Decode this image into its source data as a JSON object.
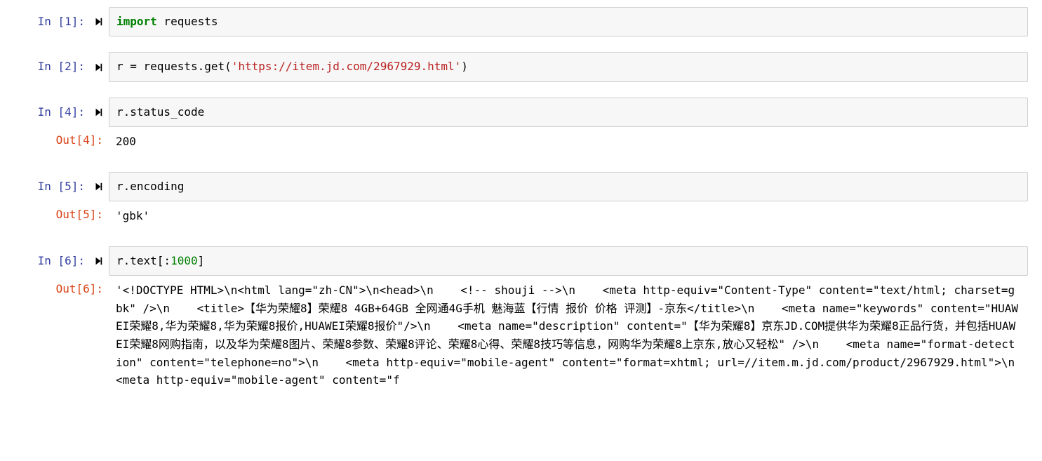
{
  "cells": [
    {
      "n": 1,
      "in_prompt": "In [1]:",
      "code": [
        {
          "t": "import",
          "c": "tok-keyword"
        },
        {
          "t": " requests",
          "c": ""
        }
      ]
    },
    {
      "n": 2,
      "in_prompt": "In [2]:",
      "code": [
        {
          "t": "r ",
          "c": ""
        },
        {
          "t": "=",
          "c": ""
        },
        {
          "t": " requests.get(",
          "c": ""
        },
        {
          "t": "'https://item.jd.com/2967929.html'",
          "c": "tok-string"
        },
        {
          "t": ")",
          "c": ""
        }
      ]
    },
    {
      "n": 4,
      "in_prompt": "In [4]:",
      "code": [
        {
          "t": "r.status_code",
          "c": ""
        }
      ],
      "out_prompt": "Out[4]:",
      "output": "200"
    },
    {
      "n": 5,
      "in_prompt": "In [5]:",
      "code": [
        {
          "t": "r.encoding",
          "c": ""
        }
      ],
      "out_prompt": "Out[5]:",
      "output": "'gbk'"
    },
    {
      "n": 6,
      "in_prompt": "In [6]:",
      "code": [
        {
          "t": "r.text[:",
          "c": ""
        },
        {
          "t": "1000",
          "c": "tok-number"
        },
        {
          "t": "]",
          "c": ""
        }
      ],
      "out_prompt": "Out[6]:",
      "output": "'<!DOCTYPE HTML>\\n<html lang=\"zh-CN\">\\n<head>\\n    <!-- shouji -->\\n    <meta http-equiv=\"Content-Type\" content=\"text/html; charset=gbk\" />\\n    <title>【华为荣耀8】荣耀8 4GB+64GB 全网通4G手机 魅海蓝【行情 报价 价格 评测】-京东</title>\\n    <meta name=\"keywords\" content=\"HUAWEI荣耀8,华为荣耀8,华为荣耀8报价,HUAWEI荣耀8报价\"/>\\n    <meta name=\"description\" content=\"【华为荣耀8】京东JD.COM提供华为荣耀8正品行货，并包括HUAWEI荣耀8网购指南，以及华为荣耀8图片、荣耀8参数、荣耀8评论、荣耀8心得、荣耀8技巧等信息，网购华为荣耀8上京东,放心又轻松\" />\\n    <meta name=\"format-detection\" content=\"telephone=no\">\\n    <meta http-equiv=\"mobile-agent\" content=\"format=xhtml; url=//item.m.jd.com/product/2967929.html\">\\n    <meta http-equiv=\"mobile-agent\" content=\"f"
    }
  ]
}
